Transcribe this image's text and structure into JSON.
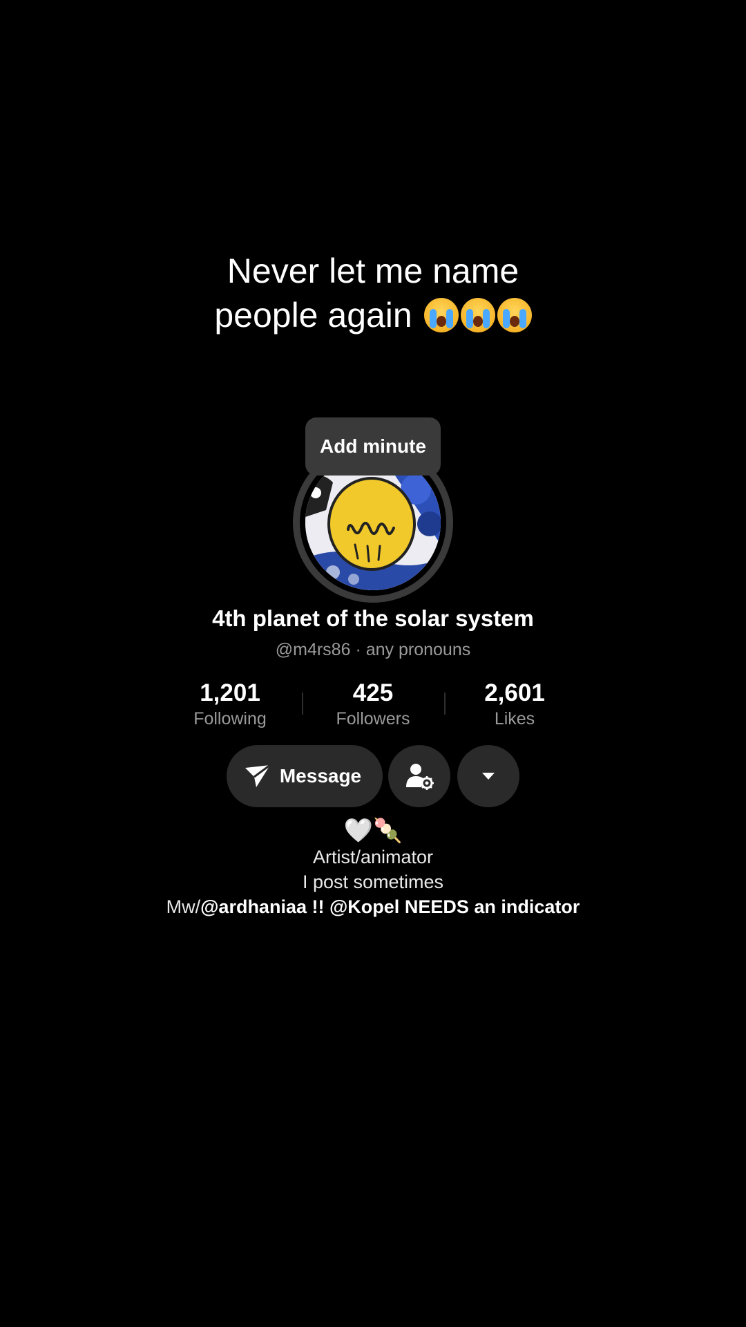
{
  "caption": {
    "line1": "Never let me name",
    "line2": "people again",
    "emojis": [
      "loudly-crying-face",
      "loudly-crying-face",
      "loudly-crying-face"
    ]
  },
  "tooltip": {
    "label": "Add minute"
  },
  "profile": {
    "name": "4th planet of the solar system",
    "handle": "@m4rs86",
    "separator": "·",
    "pronouns": "any pronouns"
  },
  "stats": [
    {
      "value": "1,201",
      "label": "Following"
    },
    {
      "value": "425",
      "label": "Followers"
    },
    {
      "value": "2,601",
      "label": "Likes"
    }
  ],
  "actions": {
    "message_label": "Message",
    "message_icon": "paper-plane-icon",
    "user_settings_icon": "user-gear-icon",
    "more_icon": "caret-down-icon"
  },
  "bio": {
    "emojis": "🤍🍡",
    "line1": "Artist/animator",
    "line2": "I post sometimes",
    "line3_prefix": "Mw/",
    "line3_mention1": "@ardhaniaa",
    "line3_middle": " !! ",
    "line3_mention2": "@Kopel",
    "line3_suffix": " NEEDS an indicator"
  },
  "colors": {
    "background": "#000000",
    "button_bg": "#2a2a2a",
    "tooltip_bg": "#3a3a3a",
    "secondary_text": "#9a9a9a"
  }
}
